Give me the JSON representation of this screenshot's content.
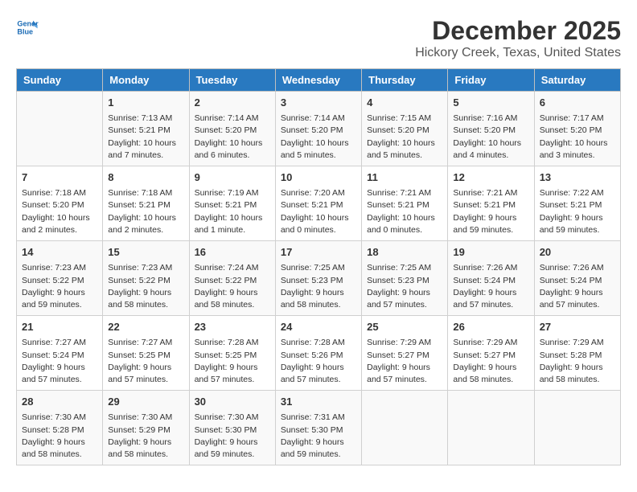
{
  "logo": {
    "line1": "General",
    "line2": "Blue"
  },
  "title": "December 2025",
  "subtitle": "Hickory Creek, Texas, United States",
  "days_of_week": [
    "Sunday",
    "Monday",
    "Tuesday",
    "Wednesday",
    "Thursday",
    "Friday",
    "Saturday"
  ],
  "weeks": [
    [
      {
        "day": "",
        "info": ""
      },
      {
        "day": "1",
        "info": "Sunrise: 7:13 AM\nSunset: 5:21 PM\nDaylight: 10 hours\nand 7 minutes."
      },
      {
        "day": "2",
        "info": "Sunrise: 7:14 AM\nSunset: 5:20 PM\nDaylight: 10 hours\nand 6 minutes."
      },
      {
        "day": "3",
        "info": "Sunrise: 7:14 AM\nSunset: 5:20 PM\nDaylight: 10 hours\nand 5 minutes."
      },
      {
        "day": "4",
        "info": "Sunrise: 7:15 AM\nSunset: 5:20 PM\nDaylight: 10 hours\nand 5 minutes."
      },
      {
        "day": "5",
        "info": "Sunrise: 7:16 AM\nSunset: 5:20 PM\nDaylight: 10 hours\nand 4 minutes."
      },
      {
        "day": "6",
        "info": "Sunrise: 7:17 AM\nSunset: 5:20 PM\nDaylight: 10 hours\nand 3 minutes."
      }
    ],
    [
      {
        "day": "7",
        "info": "Sunrise: 7:18 AM\nSunset: 5:20 PM\nDaylight: 10 hours\nand 2 minutes."
      },
      {
        "day": "8",
        "info": "Sunrise: 7:18 AM\nSunset: 5:21 PM\nDaylight: 10 hours\nand 2 minutes."
      },
      {
        "day": "9",
        "info": "Sunrise: 7:19 AM\nSunset: 5:21 PM\nDaylight: 10 hours\nand 1 minute."
      },
      {
        "day": "10",
        "info": "Sunrise: 7:20 AM\nSunset: 5:21 PM\nDaylight: 10 hours\nand 0 minutes."
      },
      {
        "day": "11",
        "info": "Sunrise: 7:21 AM\nSunset: 5:21 PM\nDaylight: 10 hours\nand 0 minutes."
      },
      {
        "day": "12",
        "info": "Sunrise: 7:21 AM\nSunset: 5:21 PM\nDaylight: 9 hours\nand 59 minutes."
      },
      {
        "day": "13",
        "info": "Sunrise: 7:22 AM\nSunset: 5:21 PM\nDaylight: 9 hours\nand 59 minutes."
      }
    ],
    [
      {
        "day": "14",
        "info": "Sunrise: 7:23 AM\nSunset: 5:22 PM\nDaylight: 9 hours\nand 59 minutes."
      },
      {
        "day": "15",
        "info": "Sunrise: 7:23 AM\nSunset: 5:22 PM\nDaylight: 9 hours\nand 58 minutes."
      },
      {
        "day": "16",
        "info": "Sunrise: 7:24 AM\nSunset: 5:22 PM\nDaylight: 9 hours\nand 58 minutes."
      },
      {
        "day": "17",
        "info": "Sunrise: 7:25 AM\nSunset: 5:23 PM\nDaylight: 9 hours\nand 58 minutes."
      },
      {
        "day": "18",
        "info": "Sunrise: 7:25 AM\nSunset: 5:23 PM\nDaylight: 9 hours\nand 57 minutes."
      },
      {
        "day": "19",
        "info": "Sunrise: 7:26 AM\nSunset: 5:24 PM\nDaylight: 9 hours\nand 57 minutes."
      },
      {
        "day": "20",
        "info": "Sunrise: 7:26 AM\nSunset: 5:24 PM\nDaylight: 9 hours\nand 57 minutes."
      }
    ],
    [
      {
        "day": "21",
        "info": "Sunrise: 7:27 AM\nSunset: 5:24 PM\nDaylight: 9 hours\nand 57 minutes."
      },
      {
        "day": "22",
        "info": "Sunrise: 7:27 AM\nSunset: 5:25 PM\nDaylight: 9 hours\nand 57 minutes."
      },
      {
        "day": "23",
        "info": "Sunrise: 7:28 AM\nSunset: 5:25 PM\nDaylight: 9 hours\nand 57 minutes."
      },
      {
        "day": "24",
        "info": "Sunrise: 7:28 AM\nSunset: 5:26 PM\nDaylight: 9 hours\nand 57 minutes."
      },
      {
        "day": "25",
        "info": "Sunrise: 7:29 AM\nSunset: 5:27 PM\nDaylight: 9 hours\nand 57 minutes."
      },
      {
        "day": "26",
        "info": "Sunrise: 7:29 AM\nSunset: 5:27 PM\nDaylight: 9 hours\nand 58 minutes."
      },
      {
        "day": "27",
        "info": "Sunrise: 7:29 AM\nSunset: 5:28 PM\nDaylight: 9 hours\nand 58 minutes."
      }
    ],
    [
      {
        "day": "28",
        "info": "Sunrise: 7:30 AM\nSunset: 5:28 PM\nDaylight: 9 hours\nand 58 minutes."
      },
      {
        "day": "29",
        "info": "Sunrise: 7:30 AM\nSunset: 5:29 PM\nDaylight: 9 hours\nand 58 minutes."
      },
      {
        "day": "30",
        "info": "Sunrise: 7:30 AM\nSunset: 5:30 PM\nDaylight: 9 hours\nand 59 minutes."
      },
      {
        "day": "31",
        "info": "Sunrise: 7:31 AM\nSunset: 5:30 PM\nDaylight: 9 hours\nand 59 minutes."
      },
      {
        "day": "",
        "info": ""
      },
      {
        "day": "",
        "info": ""
      },
      {
        "day": "",
        "info": ""
      }
    ]
  ]
}
